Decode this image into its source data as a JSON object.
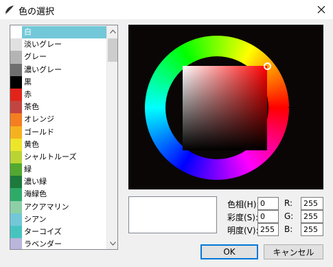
{
  "window": {
    "title": "色の選択",
    "app_icon": "paint-app-icon",
    "close_icon": "close-icon"
  },
  "color_list": {
    "items": [
      {
        "label": "白",
        "color": "#ffffff",
        "selected": true
      },
      {
        "label": "淡いグレー",
        "color": "#e0e0e0"
      },
      {
        "label": "グレー",
        "color": "#b4b4b4"
      },
      {
        "label": "濃いグレー",
        "color": "#6e6e6e"
      },
      {
        "label": "黒",
        "color": "#000000"
      },
      {
        "label": "赤",
        "color": "#e2231a"
      },
      {
        "label": "茶色",
        "color": "#c2453f"
      },
      {
        "label": "オレンジ",
        "color": "#f47e20"
      },
      {
        "label": "ゴールド",
        "color": "#f6b21e"
      },
      {
        "label": "黄色",
        "color": "#ede52a"
      },
      {
        "label": "シャルトルーズ",
        "color": "#b9d433"
      },
      {
        "label": "緑",
        "color": "#52a830"
      },
      {
        "label": "濃い緑",
        "color": "#1b7a3c"
      },
      {
        "label": "海緑色",
        "color": "#2fab69"
      },
      {
        "label": "アクアマリン",
        "color": "#8dcfa6"
      },
      {
        "label": "シアン",
        "color": "#72c8d8"
      },
      {
        "label": "ターコイズ",
        "color": "#48c4c0"
      },
      {
        "label": "ラベンダー",
        "color": "#b9b6dc"
      }
    ],
    "scroll_up_icon": "chevron-up-icon",
    "scroll_down_icon": "chevron-down-icon"
  },
  "color_wheel": {
    "hue": 0,
    "saturation": 0,
    "value": 255
  },
  "fields": {
    "hue_label": "色相(H):",
    "hue_value": "0",
    "saturation_label": "彩度(S):",
    "saturation_value": "0",
    "value_label": "明度(V):",
    "value_value": "255",
    "r_label": "R:",
    "r_value": "255",
    "g_label": "G:",
    "g_value": "255",
    "b_label": "B:",
    "b_value": "255"
  },
  "buttons": {
    "ok": "OK",
    "cancel": "キャンセル"
  },
  "preview_color": "#ffffff"
}
